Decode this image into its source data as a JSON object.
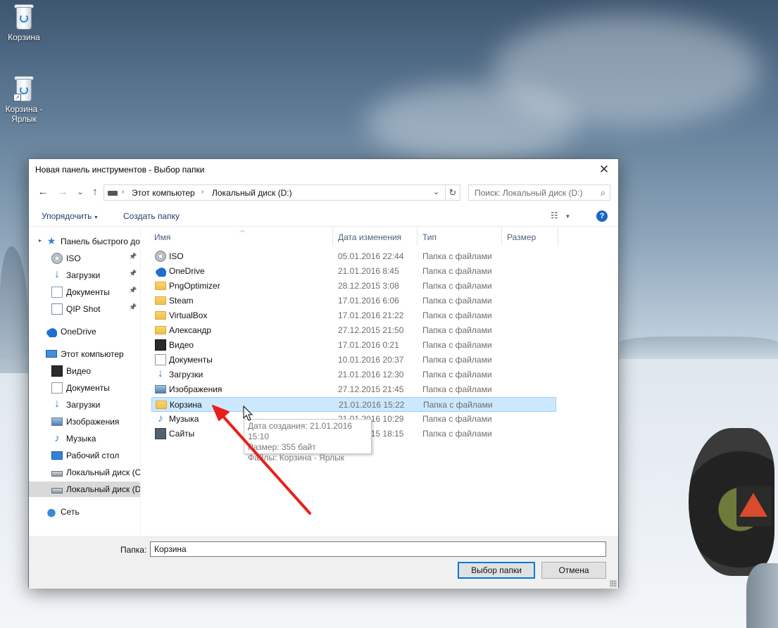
{
  "desktop": {
    "icons": [
      {
        "label": "Корзина"
      },
      {
        "label": "Корзина - Ярлык"
      }
    ]
  },
  "dialog": {
    "title": "Новая панель инструментов - Выбор папки",
    "close_glyph": "✕",
    "nav": {
      "back": "←",
      "forward": "→",
      "recent": "⌄",
      "up": "↑"
    },
    "address": {
      "crumbs": [
        "Этот компьютер",
        "Локальный диск (D:)"
      ],
      "separator": "›",
      "dropdown": "⌄",
      "refresh": "↻"
    },
    "search": {
      "placeholder": "Поиск: Локальный диск (D:)",
      "icon": "search-icon"
    },
    "commands": {
      "organize": "Упорядочить",
      "new_folder": "Создать папку",
      "caret": "▾",
      "help": "?"
    },
    "navpane": [
      {
        "label": "Панель быстрого доступа",
        "icon": "star-icon",
        "indent": 0,
        "pinned": false
      },
      {
        "label": "ISO",
        "icon": "iso-icon",
        "indent": 1,
        "pinned": true
      },
      {
        "label": "Загрузки",
        "icon": "downloads-icon",
        "indent": 1,
        "pinned": true
      },
      {
        "label": "Документы",
        "icon": "documents-icon",
        "indent": 1,
        "pinned": true
      },
      {
        "label": "QIP Shot",
        "icon": "qip-icon",
        "indent": 1,
        "pinned": true
      },
      {
        "label": "OneDrive",
        "icon": "onedrive-icon",
        "indent": 0,
        "pinned": false
      },
      {
        "label": "Этот компьютер",
        "icon": "pc-icon",
        "indent": 0,
        "pinned": false
      },
      {
        "label": "Видео",
        "icon": "video-icon",
        "indent": 1,
        "pinned": false
      },
      {
        "label": "Документы",
        "icon": "documents-icon",
        "indent": 1,
        "pinned": false
      },
      {
        "label": "Загрузки",
        "icon": "downloads-icon",
        "indent": 1,
        "pinned": false
      },
      {
        "label": "Изображения",
        "icon": "pictures-icon",
        "indent": 1,
        "pinned": false
      },
      {
        "label": "Музыка",
        "icon": "music-icon",
        "indent": 1,
        "pinned": false
      },
      {
        "label": "Рабочий стол",
        "icon": "desktop-icon",
        "indent": 1,
        "pinned": false
      },
      {
        "label": "Локальный диск (С",
        "icon": "drive-icon",
        "indent": 1,
        "pinned": false
      },
      {
        "label": "Локальный диск (D",
        "icon": "drive-icon",
        "indent": 1,
        "pinned": false,
        "selected": true
      },
      {
        "label": "Сеть",
        "icon": "network-icon",
        "indent": 0,
        "pinned": false
      }
    ],
    "columns": [
      "Имя",
      "Дата изменения",
      "Тип",
      "Размер"
    ],
    "files": [
      {
        "name": "ISO",
        "date": "05.01.2016 22:44",
        "type": "Папка с файлами",
        "icon": "iso-icon"
      },
      {
        "name": "OneDrive",
        "date": "21.01.2016 8:45",
        "type": "Папка с файлами",
        "icon": "onedrive-icon"
      },
      {
        "name": "PngOptimizer",
        "date": "28.12.2015 3:08",
        "type": "Папка с файлами",
        "icon": "folder-icon"
      },
      {
        "name": "Steam",
        "date": "17.01.2016 6:06",
        "type": "Папка с файлами",
        "icon": "folder-icon"
      },
      {
        "name": "VirtualBox",
        "date": "17.01.2016 21:22",
        "type": "Папка с файлами",
        "icon": "folder-icon"
      },
      {
        "name": "Александр",
        "date": "27.12.2015 21:50",
        "type": "Папка с файлами",
        "icon": "folder-icon"
      },
      {
        "name": "Видео",
        "date": "17.01.2016 0:21",
        "type": "Папка с файлами",
        "icon": "video-icon"
      },
      {
        "name": "Документы",
        "date": "10.01.2016 20:37",
        "type": "Папка с файлами",
        "icon": "documents-icon"
      },
      {
        "name": "Загрузки",
        "date": "21.01.2016 12:30",
        "type": "Папка с файлами",
        "icon": "downloads-icon"
      },
      {
        "name": "Изображения",
        "date": "27.12.2015 21:45",
        "type": "Папка с файлами",
        "icon": "pictures-icon"
      },
      {
        "name": "Корзина",
        "date": "21.01.2016 15:22",
        "type": "Папка с файлами",
        "icon": "folder-icon",
        "selected": true
      },
      {
        "name": "Музыка",
        "date": "21.01.2016 10:29",
        "type": "Папка с файлами",
        "icon": "music-icon"
      },
      {
        "name": "Сайты",
        "date": "29.12.2015 18:15",
        "type": "Папка с файлами",
        "icon": "save-icon"
      }
    ],
    "tooltip": [
      "Дата создания: 21.01.2016 15:10",
      "Размер: 355 байт",
      "Файлы: Корзина - Ярлык"
    ],
    "folder_label": "Папка:",
    "folder_value": "Корзина",
    "ok_button": "Выбор папки",
    "cancel_button": "Отмена"
  },
  "colors": {
    "selection": "#cce8ff",
    "accent": "#0078d7",
    "arrow": "#e8201a"
  }
}
